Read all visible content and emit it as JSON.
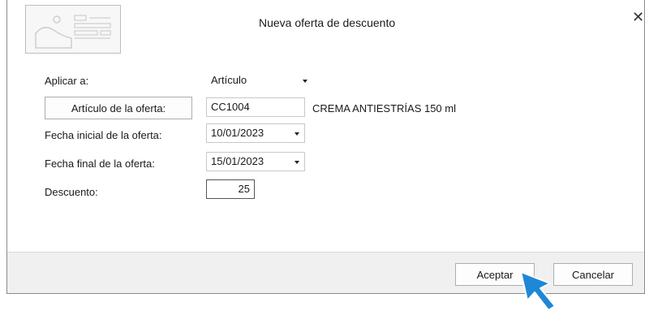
{
  "dialog": {
    "title": "Nueva oferta de descuento",
    "close_label": "✕"
  },
  "form": {
    "apply_label": "Aplicar a:",
    "apply_value": "Artículo",
    "article_button_label": "Artículo de la oferta:",
    "article_code": "CC1004",
    "article_description": "CREMA ANTIESTRÍAS 150 ml",
    "start_date_label": "Fecha inicial de la oferta:",
    "start_date_value": "10/01/2023",
    "end_date_label": "Fecha final de la oferta:",
    "end_date_value": "15/01/2023",
    "discount_label": "Descuento:",
    "discount_value": "25"
  },
  "footer": {
    "accept_label": "Aceptar",
    "cancel_label": "Cancelar"
  },
  "icons": {
    "header": "image-placeholder-icon",
    "cursor": "mouse-pointer-icon"
  },
  "colors": {
    "cursor": "#1e88d6",
    "footer_bg": "#f0f0f0"
  }
}
